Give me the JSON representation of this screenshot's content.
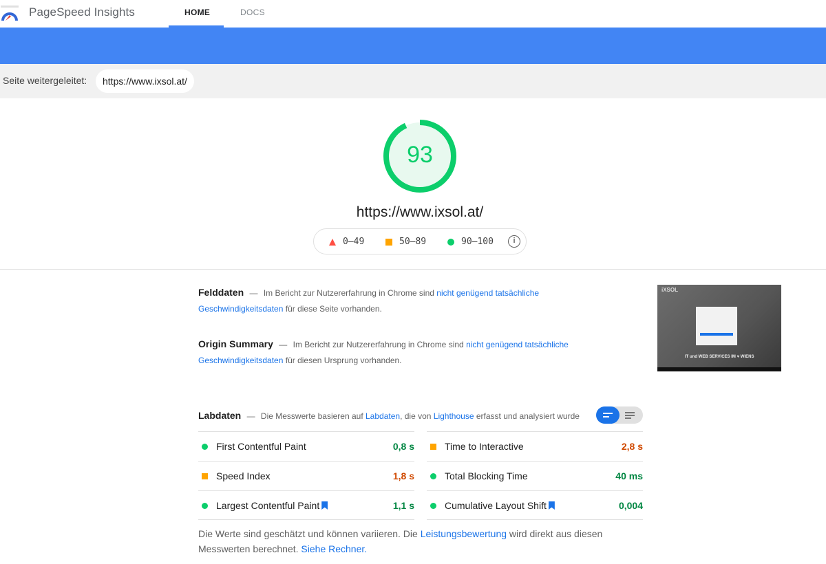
{
  "header": {
    "app_title": "PageSpeed Insights",
    "tabs": [
      {
        "label": "HOME",
        "active": true
      },
      {
        "label": "DOCS",
        "active": false
      }
    ]
  },
  "redirect": {
    "label": "Seite weitergeleitet:",
    "url": "https://www.ixsol.at/"
  },
  "score": {
    "value": "93",
    "fraction": 0.93,
    "color": "#0cce6b"
  },
  "tested_url": "https://www.ixsol.at/",
  "legend": {
    "fail": "0–49",
    "average": "50–89",
    "pass": "90–100",
    "info": "i"
  },
  "field_data": {
    "title": "Felddaten",
    "dash": "—",
    "text_before": "Im Bericht zur Nutzererfahrung in Chrome sind",
    "link": "nicht genügend tatsächliche Geschwindigkeitsdaten",
    "text_after": "für diese Seite vorhanden."
  },
  "origin_summary": {
    "title": "Origin Summary",
    "dash": "—",
    "text_before": "Im Bericht zur Nutzererfahrung in Chrome sind",
    "link": "nicht genügend tatsächliche Geschwindigkeitsdaten",
    "text_after": "für diesen Ursprung vorhanden."
  },
  "thumbnail": {
    "logo": "iXSOL",
    "caption": "IT und WEB SERVICES IM ♥ WIENS"
  },
  "lab_data": {
    "title": "Labdaten",
    "dash": "—",
    "text_1": "Die Messwerte basieren auf",
    "link_1": "Labdaten",
    "text_2": ", die von",
    "link_2": "Lighthouse",
    "text_3": "erfasst und analysiert wurde"
  },
  "metrics": {
    "left": [
      {
        "label": "First Contentful Paint",
        "value": "0,8 s",
        "status": "pass",
        "bookmark": false
      },
      {
        "label": "Speed Index",
        "value": "1,8 s",
        "status": "average",
        "bookmark": false
      },
      {
        "label": "Largest Contentful Paint",
        "value": "1,1 s",
        "status": "pass",
        "bookmark": true
      }
    ],
    "right": [
      {
        "label": "Time to Interactive",
        "value": "2,8 s",
        "status": "average",
        "bookmark": false
      },
      {
        "label": "Total Blocking Time",
        "value": "40 ms",
        "status": "pass",
        "bookmark": false
      },
      {
        "label": "Cumulative Layout Shift",
        "value": "0,004",
        "status": "pass",
        "bookmark": true
      }
    ]
  },
  "footnote": {
    "text_1": "Die Werte sind geschätzt und können variieren. Die",
    "link_1": "Leistungsbewertung",
    "text_2": "wird direkt aus diesen Messwerten berechnet.",
    "link_2": "Siehe Rechner."
  },
  "colors": {
    "accent": "#4285f4",
    "pass": "#0cce6b",
    "average": "#ffa400",
    "fail": "#ff4e42",
    "link": "#1a73e8"
  }
}
